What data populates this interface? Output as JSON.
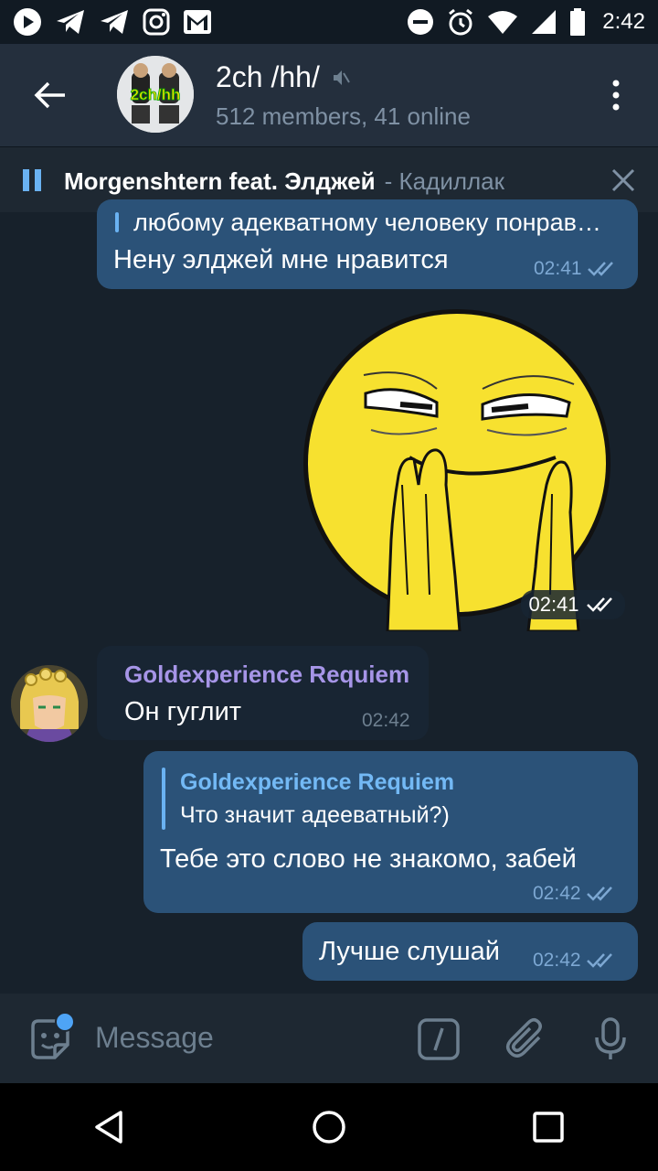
{
  "status_bar": {
    "time": "2:42",
    "left_icons": [
      "play-icon",
      "telegram-icon",
      "telegram-icon",
      "instagram-icon",
      "gmail-icon"
    ],
    "right_icons": [
      "dnd-icon",
      "alarm-icon",
      "wifi-icon",
      "signal-icon",
      "battery-icon"
    ]
  },
  "header": {
    "title": "2ch /hh/",
    "subtitle": "512 members, 41 online",
    "avatar_text": "2ch/hh"
  },
  "player": {
    "artist": "Morgenshtern feat. Элджей",
    "title": "- Кадиллак"
  },
  "messages": [
    {
      "id": "m1",
      "direction": "out",
      "quoted_text": "любому адекватному человеку понрав…",
      "text": "Нену элджей мне нравится",
      "time": "02:41",
      "read": true
    },
    {
      "id": "m2",
      "direction": "out",
      "type": "sticker",
      "sticker": "smug-face-sticker",
      "time": "02:41",
      "read": true
    },
    {
      "id": "m3",
      "direction": "in",
      "sender": "Goldexperience Requiem",
      "text": "Он гуглит",
      "time": "02:42"
    },
    {
      "id": "m4",
      "direction": "out",
      "reply_to": {
        "name": "Goldexperience Requiem",
        "text": "Что значит адееватный?)"
      },
      "text": "Тебе это слово не знакомо, забей",
      "time": "02:42",
      "read": true
    },
    {
      "id": "m5",
      "direction": "out",
      "text": "Лучше слушай",
      "time": "02:42",
      "read": true
    }
  ],
  "composer": {
    "placeholder": "Message"
  },
  "colors": {
    "background": "#17212b",
    "header": "#242f3d",
    "outgoing_bubble": "#2b5278",
    "incoming_bubble": "#182533",
    "accent": "#6ab2f2",
    "sender_name": "#a695e7"
  }
}
